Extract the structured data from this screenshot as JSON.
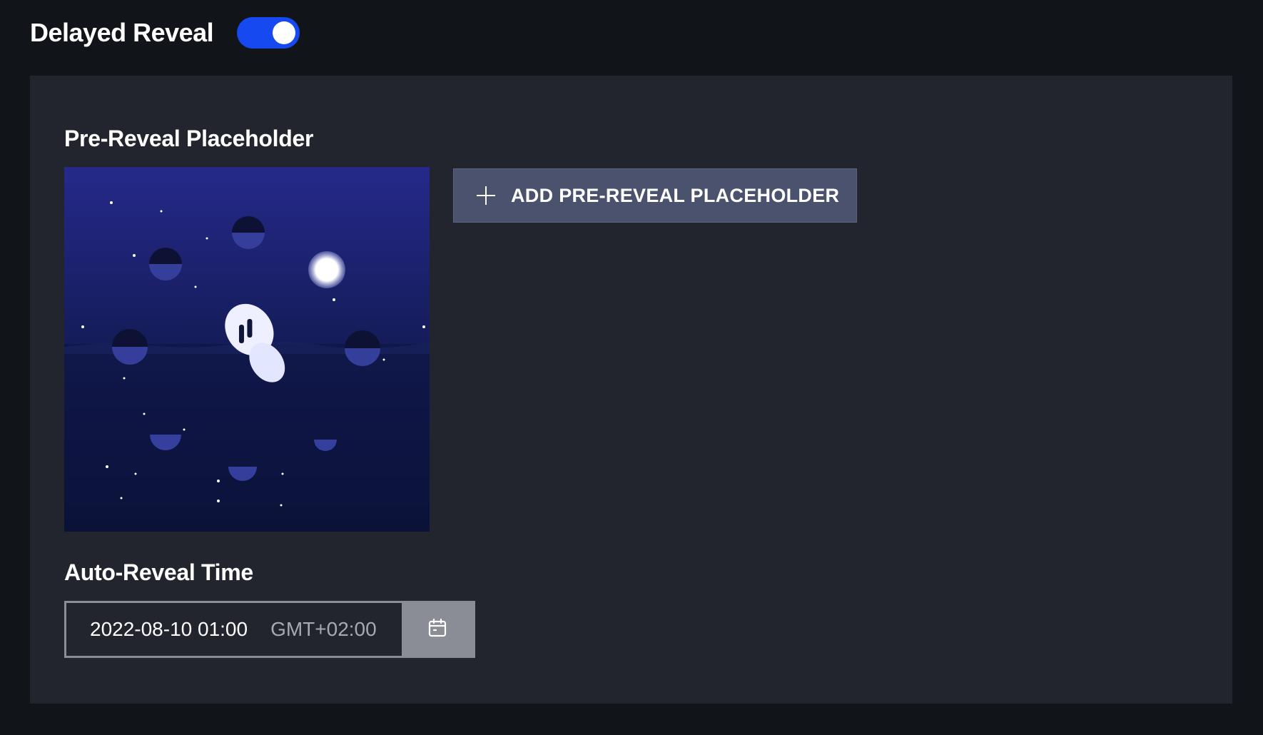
{
  "header": {
    "title": "Delayed Reveal",
    "toggle_on": true,
    "toggle_color": "#1649f0"
  },
  "placeholder_section": {
    "label": "Pre-Reveal Placeholder",
    "image_description_icon": "ghost-night-artwork",
    "add_button_label": "ADD PRE-REVEAL PLACEHOLDER",
    "add_button_icon": "plus-icon"
  },
  "auto_reveal": {
    "label": "Auto-Reveal Time",
    "datetime_value": "2022-08-10 01:00",
    "timezone": "GMT+02:00",
    "picker_icon": "calendar-icon"
  },
  "colors": {
    "page_bg": "#111519",
    "panel_bg": "#22252e",
    "button_bg": "#4b526e",
    "picker_bg": "#8a8d95"
  }
}
